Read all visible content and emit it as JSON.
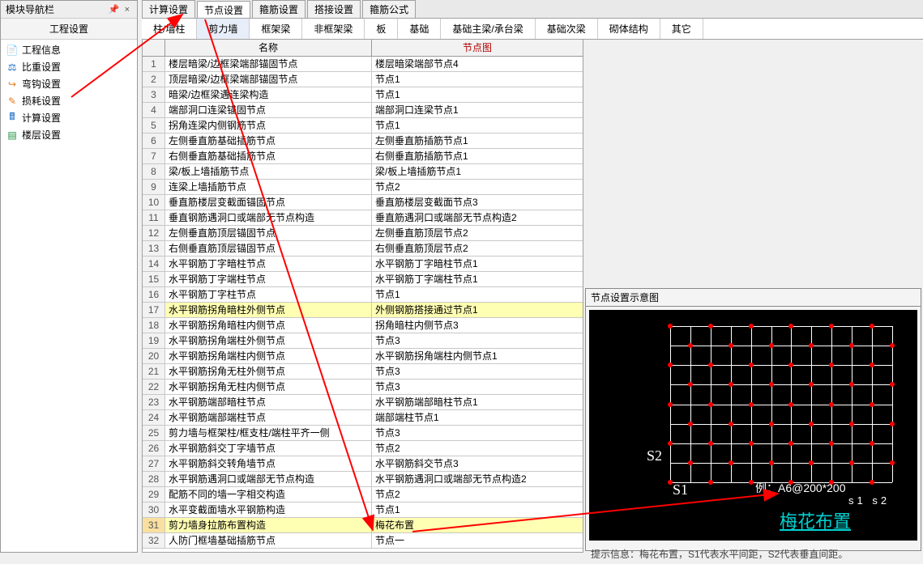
{
  "sidebar": {
    "panel_title": "模块导航栏",
    "header": "工程设置",
    "items": [
      {
        "label": "工程信息"
      },
      {
        "label": "比重设置"
      },
      {
        "label": "弯钩设置"
      },
      {
        "label": "损耗设置"
      },
      {
        "label": "计算设置"
      },
      {
        "label": "楼层设置"
      }
    ]
  },
  "top_tabs": {
    "items": [
      {
        "label": "计算设置"
      },
      {
        "label": "节点设置"
      },
      {
        "label": "箍筋设置"
      },
      {
        "label": "搭接设置"
      },
      {
        "label": "箍筋公式"
      }
    ],
    "active_index": 1
  },
  "sub_tabs": {
    "items": [
      {
        "label": "柱/墙柱"
      },
      {
        "label": "剪力墙"
      },
      {
        "label": "框架梁"
      },
      {
        "label": "非框架梁"
      },
      {
        "label": "板"
      },
      {
        "label": "基础"
      },
      {
        "label": "基础主梁/承台梁"
      },
      {
        "label": "基础次梁"
      },
      {
        "label": "砌体结构"
      },
      {
        "label": "其它"
      }
    ],
    "active_index": 1
  },
  "grid": {
    "col_name_header": "名称",
    "col_img_header": "节点图",
    "rows": [
      {
        "n": 1,
        "name": "楼层暗梁/边框梁端部锚固节点",
        "img": "楼层暗梁端部节点4"
      },
      {
        "n": 2,
        "name": "顶层暗梁/边框梁端部锚固节点",
        "img": "节点1"
      },
      {
        "n": 3,
        "name": "暗梁/边框梁遇连梁构造",
        "img": "节点1"
      },
      {
        "n": 4,
        "name": "端部洞口连梁锚固节点",
        "img": "端部洞口连梁节点1"
      },
      {
        "n": 5,
        "name": "拐角连梁内侧钢筋节点",
        "img": "节点1"
      },
      {
        "n": 6,
        "name": "左侧垂直筋基础插筋节点",
        "img": "左侧垂直筋插筋节点1"
      },
      {
        "n": 7,
        "name": "右侧垂直筋基础插筋节点",
        "img": "右侧垂直筋插筋节点1"
      },
      {
        "n": 8,
        "name": "梁/板上墙插筋节点",
        "img": "梁/板上墙插筋节点1"
      },
      {
        "n": 9,
        "name": "连梁上墙插筋节点",
        "img": "节点2"
      },
      {
        "n": 10,
        "name": "垂直筋楼层变截面锚固节点",
        "img": "垂直筋楼层变截面节点3"
      },
      {
        "n": 11,
        "name": "垂直钢筋遇洞口或端部无节点构造",
        "img": "垂直筋遇洞口或端部无节点构造2"
      },
      {
        "n": 12,
        "name": "左侧垂直筋顶层锚固节点",
        "img": "左侧垂直筋顶层节点2"
      },
      {
        "n": 13,
        "name": "右侧垂直筋顶层锚固节点",
        "img": "右侧垂直筋顶层节点2"
      },
      {
        "n": 14,
        "name": "水平钢筋丁字暗柱节点",
        "img": "水平钢筋丁字暗柱节点1"
      },
      {
        "n": 15,
        "name": "水平钢筋丁字端柱节点",
        "img": "水平钢筋丁字端柱节点1"
      },
      {
        "n": 16,
        "name": "水平钢筋丁字柱节点",
        "img": "节点1"
      },
      {
        "n": 17,
        "name": "水平钢筋拐角暗柱外侧节点",
        "img": "外侧钢筋搭接通过节点1",
        "hl": true
      },
      {
        "n": 18,
        "name": "水平钢筋拐角暗柱内侧节点",
        "img": "拐角暗柱内侧节点3"
      },
      {
        "n": 19,
        "name": "水平钢筋拐角端柱外侧节点",
        "img": "节点3"
      },
      {
        "n": 20,
        "name": "水平钢筋拐角端柱内侧节点",
        "img": "水平钢筋拐角端柱内侧节点1"
      },
      {
        "n": 21,
        "name": "水平钢筋拐角无柱外侧节点",
        "img": "节点3"
      },
      {
        "n": 22,
        "name": "水平钢筋拐角无柱内侧节点",
        "img": "节点3"
      },
      {
        "n": 23,
        "name": "水平钢筋端部暗柱节点",
        "img": "水平钢筋端部暗柱节点1"
      },
      {
        "n": 24,
        "name": "水平钢筋端部端柱节点",
        "img": "端部端柱节点1"
      },
      {
        "n": 25,
        "name": "剪力墙与框架柱/框支柱/端柱平齐一侧",
        "img": "节点3"
      },
      {
        "n": 26,
        "name": "水平钢筋斜交丁字墙节点",
        "img": "节点2"
      },
      {
        "n": 27,
        "name": "水平钢筋斜交转角墙节点",
        "img": "水平钢筋斜交节点3"
      },
      {
        "n": 28,
        "name": "水平钢筋遇洞口或端部无节点构造",
        "img": "水平钢筋遇洞口或端部无节点构造2"
      },
      {
        "n": 29,
        "name": "配筋不同的墙一字相交构造",
        "img": "节点2"
      },
      {
        "n": 30,
        "name": "水平变截面墙水平钢筋构造",
        "img": "节点1"
      },
      {
        "n": 31,
        "name": "剪力墙身拉筋布置构造",
        "img": "梅花布置",
        "hl": true,
        "sel": true
      },
      {
        "n": 32,
        "name": "人防门框墙基础插筋节点",
        "img": "节点一"
      }
    ]
  },
  "preview": {
    "title": "节点设置示意图",
    "label_s1": "S1",
    "label_s2": "S2",
    "main_label": "梅花布置",
    "example_text": "例：A6@200*200",
    "s1s2_text": "s1  s2",
    "footer": "提示信息：梅花布置，S1代表水平间距，S2代表垂直间距。"
  }
}
